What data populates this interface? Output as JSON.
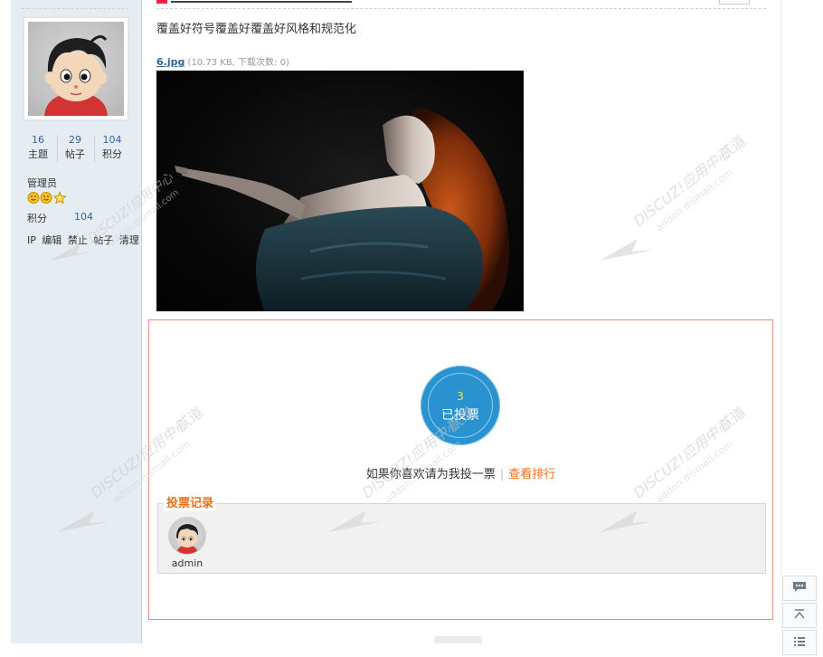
{
  "sidebar": {
    "stats": [
      {
        "value": "16",
        "label": "主题"
      },
      {
        "value": "29",
        "label": "帖子"
      },
      {
        "value": "104",
        "label": "积分"
      }
    ],
    "role": "管理员",
    "stars_icon": "medal-stars-icon",
    "points_label": "积分",
    "points_value": "104",
    "admin_links": [
      "IP",
      "编辑",
      "禁止",
      "帖子",
      "清理"
    ]
  },
  "post": {
    "text": "覆盖好符号覆盖好覆盖好风格和规范化",
    "attachment": {
      "filename": "6.jpg",
      "meta": "(10.73 KB, 下载次数: 0)"
    }
  },
  "vote": {
    "count": "3",
    "status": "已投票",
    "prompt": "如果你喜欢请为我投一票",
    "separator": "|",
    "rank_link": "查看排行",
    "records_title": "投票记录",
    "voters": [
      {
        "name": "admin"
      }
    ]
  },
  "watermark": {
    "text_main": "DISCUZ!应用中心",
    "text_brand": "贰道",
    "text_url": "addon.dismall.com"
  },
  "colors": {
    "accent": "#2a93cf",
    "link": "#336699",
    "orange": "#ef6f1a",
    "border_red": "#e28f8a"
  }
}
